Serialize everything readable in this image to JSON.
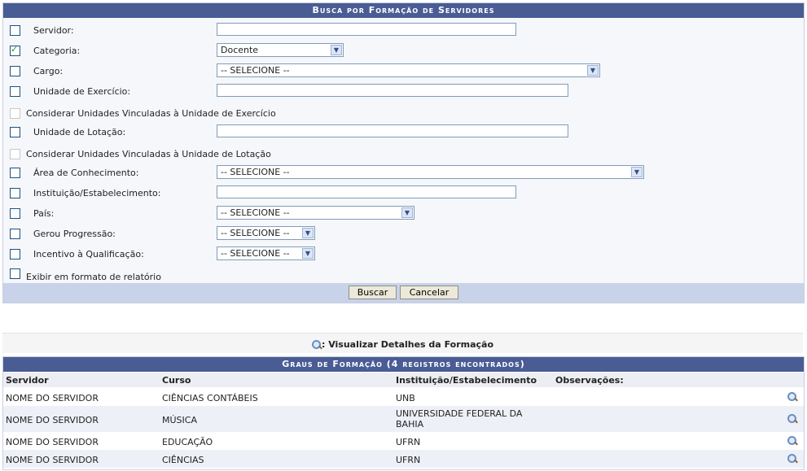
{
  "form": {
    "title": "Busca por Formação de Servidores",
    "servidor_label": "Servidor:",
    "categoria_label": "Categoria:",
    "categoria_value": "Docente",
    "cargo_label": "Cargo:",
    "cargo_value": "-- SELECIONE --",
    "unidade_exercicio_label": "Unidade de Exercício:",
    "considerar_exercicio_label": "Considerar Unidades Vinculadas à Unidade de Exercício",
    "unidade_lotacao_label": "Unidade de Lotação:",
    "considerar_lotacao_label": "Considerar Unidades Vinculadas à Unidade de Lotação",
    "area_label": "Área de Conhecimento:",
    "area_value": "-- SELECIONE --",
    "instituicao_label": "Instituição/Estabelecimento:",
    "pais_label": "País:",
    "pais_value": "-- SELECIONE --",
    "gerou_label": "Gerou Progressão:",
    "gerou_value": "-- SELECIONE --",
    "incentivo_label": "Incentivo à Qualificação:",
    "incentivo_value": "-- SELECIONE --",
    "relatorio_label": "Exibir em formato de relatório",
    "buscar_label": "Buscar",
    "cancelar_label": "Cancelar"
  },
  "legend": {
    "icon": "magnifier-icon",
    "text": ": Visualizar Detalhes da Formação"
  },
  "results": {
    "title": "Graus de Formação (4 registros encontrados)",
    "columns": [
      "Servidor",
      "Curso",
      "Instituição/Estabelecimento",
      "Observações:"
    ],
    "rows": [
      {
        "servidor": "NOME DO SERVIDOR",
        "curso": "CIÊNCIAS CONTÁBEIS",
        "instituicao": "UNB",
        "instituicao2": ""
      },
      {
        "servidor": "NOME DO SERVIDOR",
        "curso": "MÚSICA",
        "instituicao": "UNIVERSIDADE FEDERAL DA",
        "instituicao2": "BAHIA"
      },
      {
        "servidor": "NOME DO SERVIDOR",
        "curso": "EDUCAÇÃO",
        "instituicao": "UFRN",
        "instituicao2": ""
      },
      {
        "servidor": "NOME DO SERVIDOR",
        "curso": "CIÊNCIAS",
        "instituicao": "UFRN",
        "instituicao2": ""
      }
    ]
  }
}
